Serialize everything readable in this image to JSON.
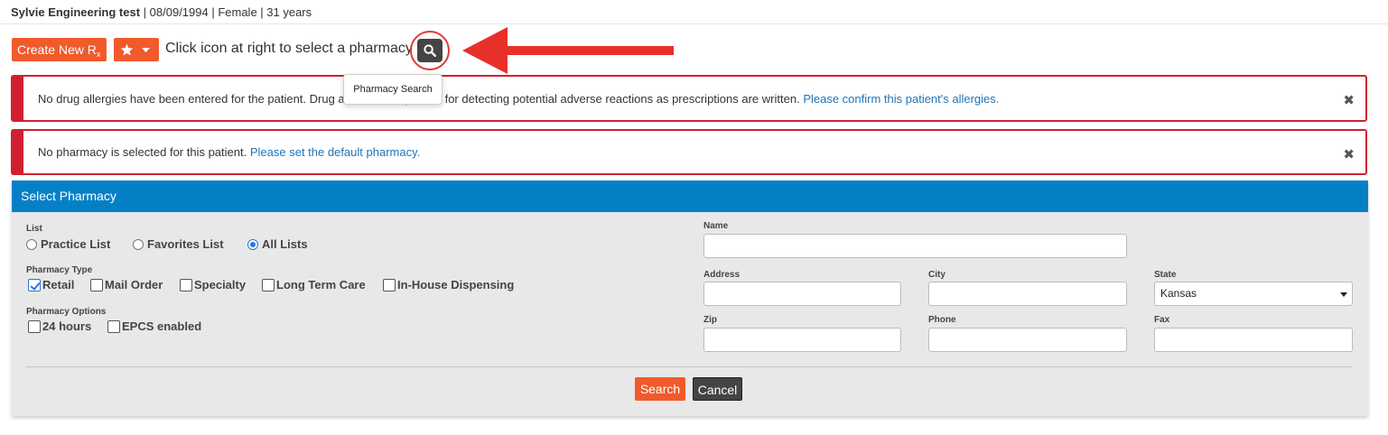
{
  "patient": {
    "name": "Sylvie Engineering test",
    "details": "| 08/09/1994 | Female | 31 years"
  },
  "toolbar": {
    "create_label": "Create New R",
    "create_sub": "x",
    "hint": "Click icon at right to select a pharmacy",
    "tooltip": "Pharmacy Search"
  },
  "alerts": [
    {
      "message": "No drug allergies have been entered for the patient. Drug a",
      "message_tail": "mportant for detecting potential adverse reactions as prescriptions are written.",
      "link": "Please confirm this patient's allergies."
    },
    {
      "message": "No pharmacy is selected for this patient.",
      "link": "Please set the default pharmacy."
    }
  ],
  "panel": {
    "title": "Select Pharmacy",
    "list": {
      "label": "List",
      "options": [
        "Practice List",
        "Favorites List",
        "All Lists"
      ],
      "selected": "All Lists"
    },
    "pharmacy_type": {
      "label": "Pharmacy Type",
      "options": [
        "Retail",
        "Mail Order",
        "Specialty",
        "Long Term Care",
        "In-House Dispensing"
      ],
      "checked": [
        "Retail"
      ]
    },
    "pharmacy_options": {
      "label": "Pharmacy Options",
      "options": [
        "24 hours",
        "EPCS enabled"
      ],
      "checked": []
    },
    "fields": {
      "name": {
        "label": "Name",
        "value": ""
      },
      "address": {
        "label": "Address",
        "value": ""
      },
      "city": {
        "label": "City",
        "value": ""
      },
      "state": {
        "label": "State",
        "value": "Kansas"
      },
      "zip": {
        "label": "Zip",
        "value": ""
      },
      "phone": {
        "label": "Phone",
        "value": ""
      },
      "fax": {
        "label": "Fax",
        "value": ""
      }
    },
    "search_label": "Search",
    "cancel_label": "Cancel"
  },
  "colors": {
    "accent": "#f15a2b",
    "header_blue": "#0580c7",
    "alert_red": "#d0202f",
    "link": "#1f74b8",
    "annotation_red": "#e03a3a"
  }
}
